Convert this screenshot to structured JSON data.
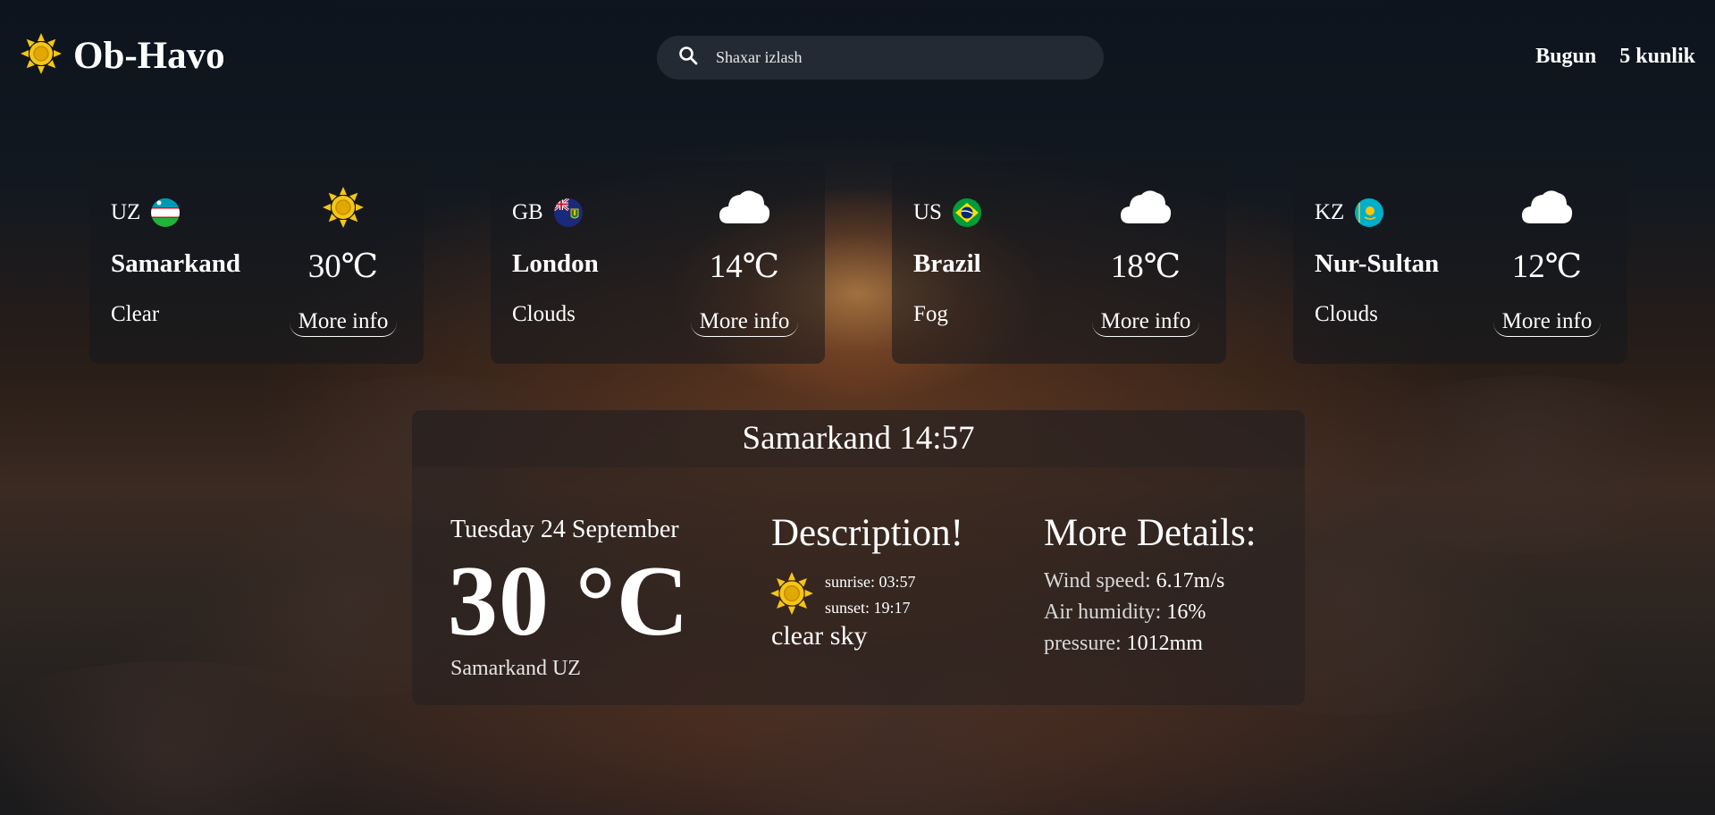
{
  "app": {
    "title": "Ob-Havo"
  },
  "search": {
    "placeholder": "Shaxar izlash"
  },
  "nav": {
    "items": [
      {
        "label": "Bugun"
      },
      {
        "label": "5 kunlik"
      }
    ]
  },
  "cards": [
    {
      "code": "UZ",
      "flag": "uzbekistan-flag-icon",
      "city": "Samarkand",
      "condition": "Clear",
      "icon": "sun-icon",
      "temp": "30℃",
      "more": "More info"
    },
    {
      "code": "GB",
      "flag": "virgin-islands-flag-icon",
      "city": "London",
      "condition": "Clouds",
      "icon": "cloud-icon",
      "temp": "14℃",
      "more": "More info"
    },
    {
      "code": "US",
      "flag": "brazil-flag-icon",
      "city": "Brazil",
      "condition": "Fog",
      "icon": "cloud-icon",
      "temp": "18℃",
      "more": "More info"
    },
    {
      "code": "KZ",
      "flag": "kazakhstan-flag-icon",
      "city": "Nur-Sultan",
      "condition": "Clouds",
      "icon": "cloud-icon",
      "temp": "12℃",
      "more": "More info"
    }
  ],
  "detail": {
    "header": "Samarkand 14:57",
    "date": "Tuesday 24 September",
    "temp": "30 °C",
    "location": "Samarkand UZ",
    "description_title": "Description!",
    "sunrise": "sunrise: 03:57",
    "sunset": "sunset: 19:17",
    "sky": "clear sky",
    "more_title": "More Details:",
    "wind_label": "Wind speed:",
    "wind_value": "6.17m/s",
    "humidity_label": "Air humidity:",
    "humidity_value": "16%",
    "pressure_label": "pressure:",
    "pressure_value": "1012mm"
  },
  "colors": {
    "sun": "#f5c518",
    "sun_center": "#e0a800",
    "cloud": "#ffffff"
  }
}
